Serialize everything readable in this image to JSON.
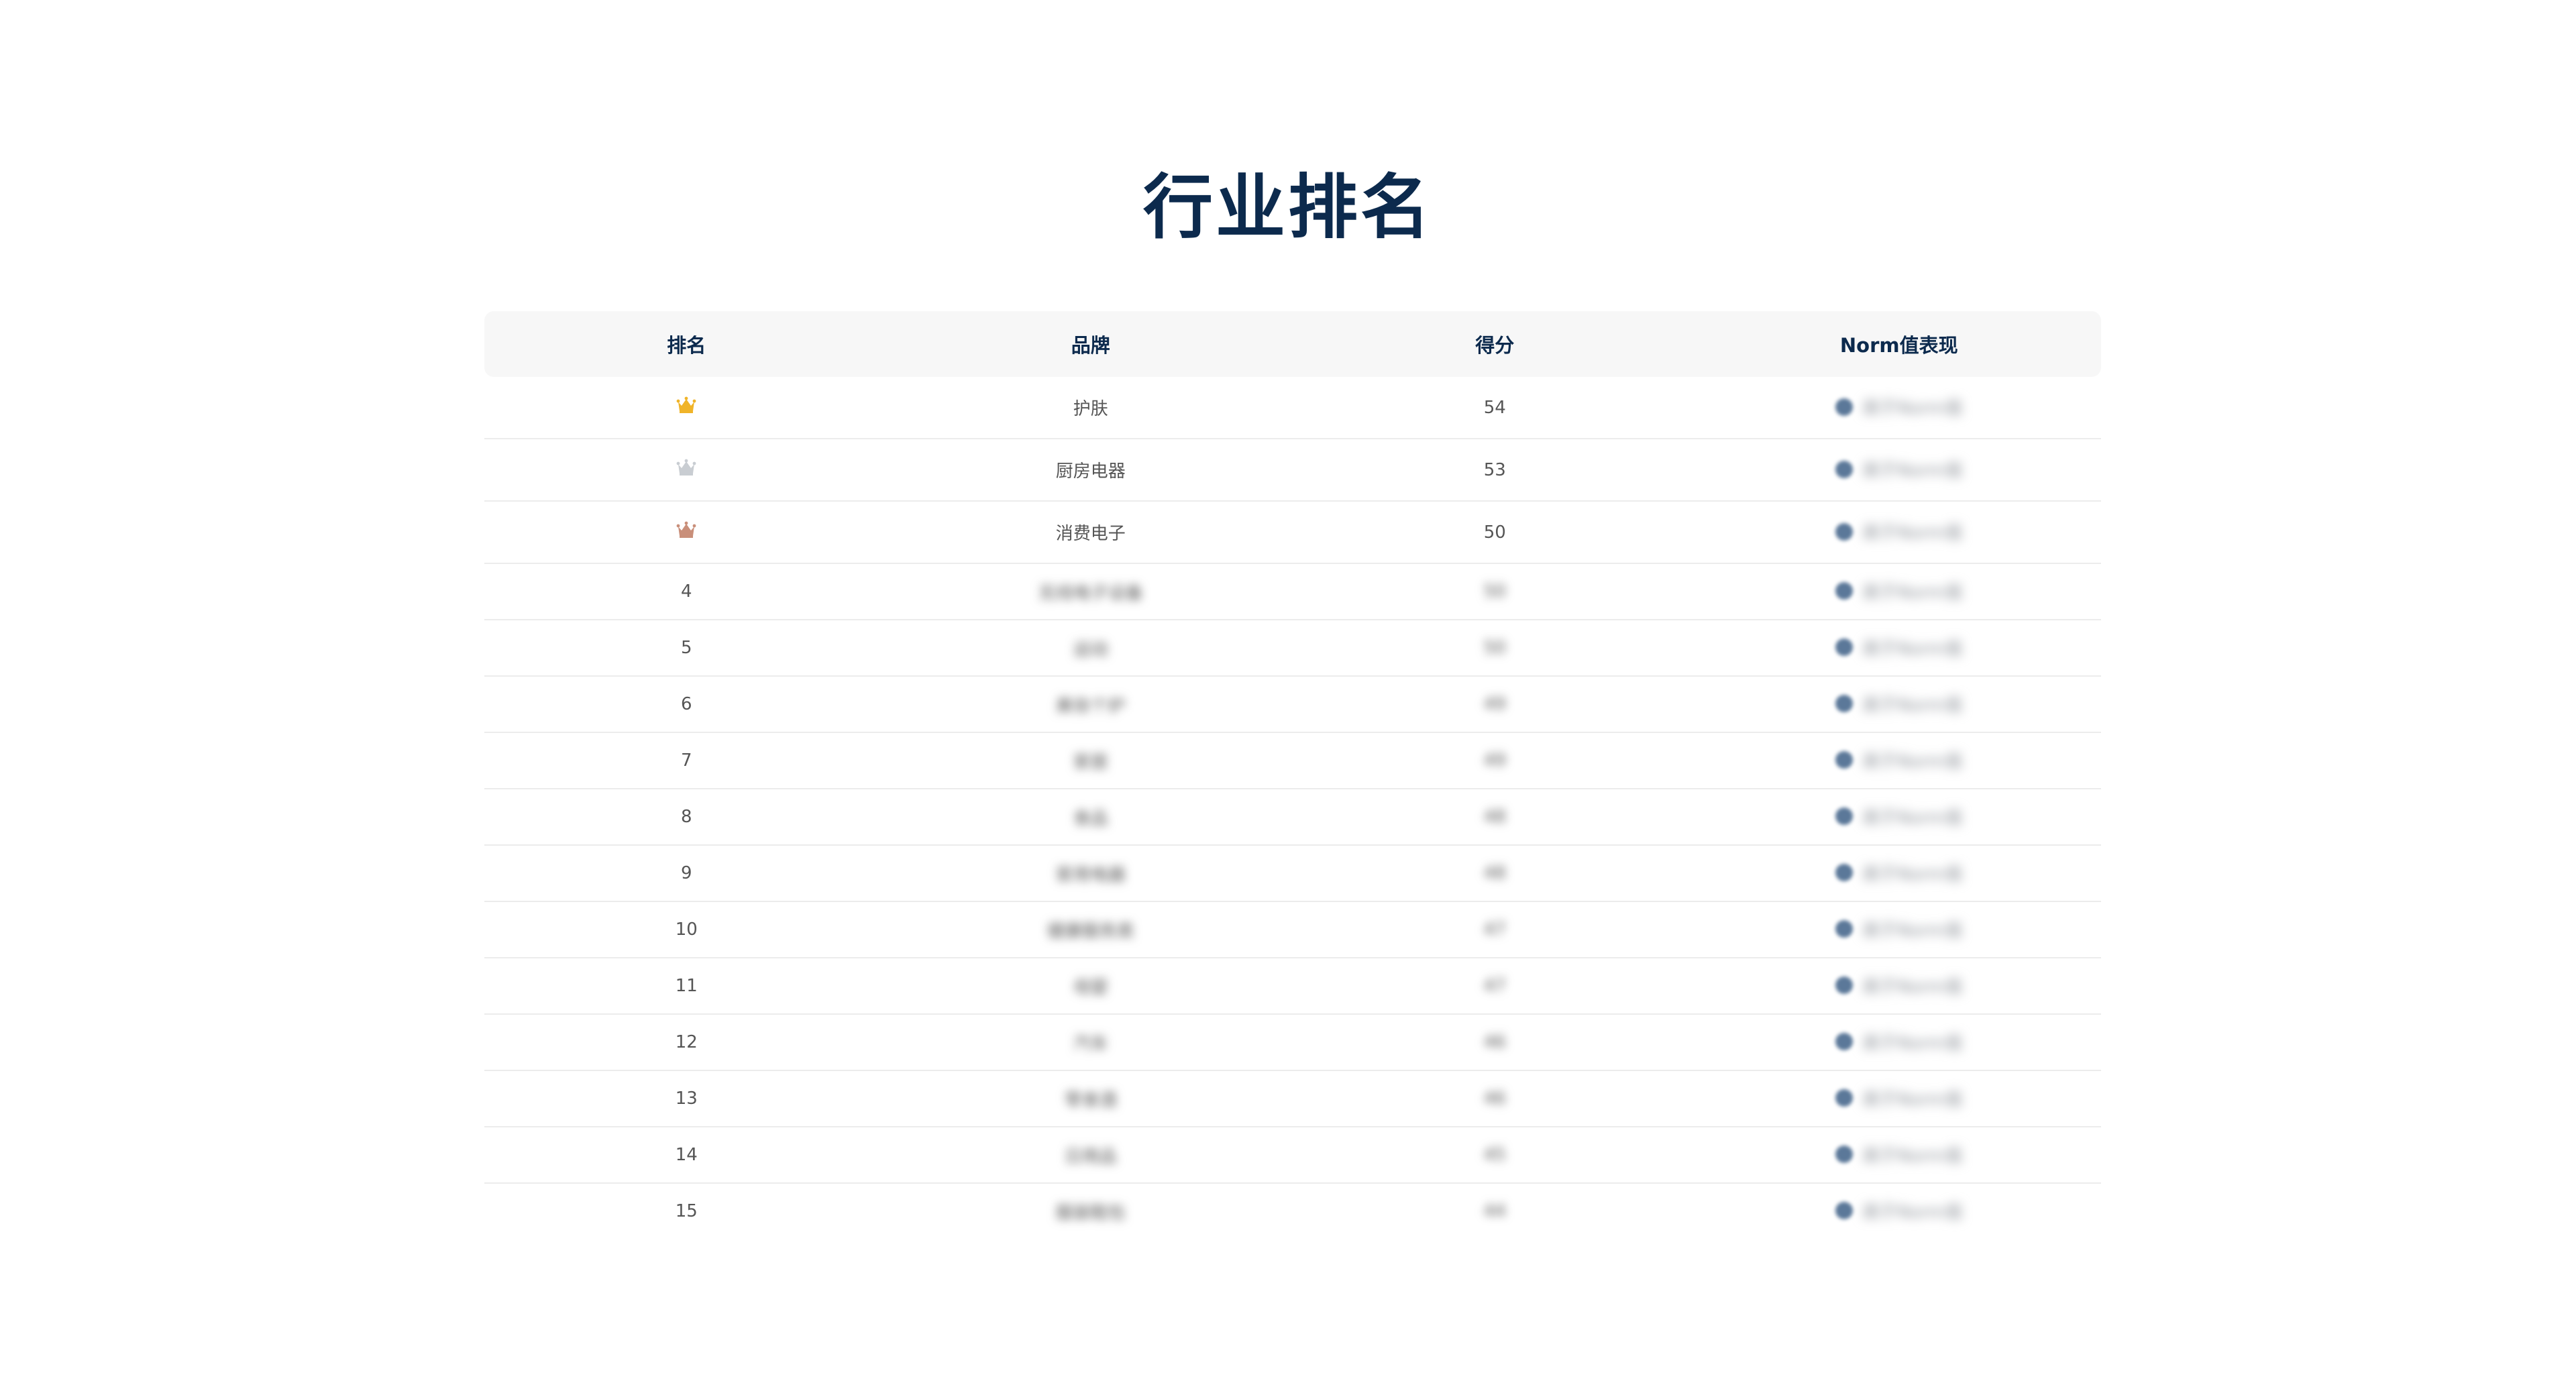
{
  "page": {
    "title": "行业排名"
  },
  "table": {
    "headers": {
      "rank": "排名",
      "brand": "品牌",
      "score": "得分",
      "norm": "Norm值表现"
    },
    "rows": [
      {
        "rank": "1",
        "crown": "gold-crown-icon",
        "brand": "护肤",
        "score": "54",
        "norm": "高于Norm值"
      },
      {
        "rank": "2",
        "crown": "silver-crown-icon",
        "brand": "厨房电器",
        "score": "53",
        "norm": "高于Norm值"
      },
      {
        "rank": "3",
        "crown": "bronze-crown-icon",
        "brand": "消费电子",
        "score": "50",
        "norm": "高于Norm值"
      },
      {
        "rank": "4",
        "brand": "无线电子设备",
        "score": "50",
        "norm": "高于Norm值"
      },
      {
        "rank": "5",
        "brand": "运动",
        "score": "50",
        "norm": "高于Norm值"
      },
      {
        "rank": "6",
        "brand": "美妆个护",
        "score": "49",
        "norm": "高于Norm值"
      },
      {
        "rank": "7",
        "brand": "家居",
        "score": "49",
        "norm": "高于Norm值"
      },
      {
        "rank": "8",
        "brand": "食品",
        "score": "48",
        "norm": "高于Norm值"
      },
      {
        "rank": "9",
        "brand": "家用电器",
        "score": "48",
        "norm": "高于Norm值"
      },
      {
        "rank": "10",
        "brand": "健康服务类",
        "score": "47",
        "norm": "高于Norm值"
      },
      {
        "rank": "11",
        "brand": "母婴",
        "score": "47",
        "norm": "高于Norm值"
      },
      {
        "rank": "12",
        "brand": "汽车",
        "score": "46",
        "norm": "高于Norm值"
      },
      {
        "rank": "13",
        "brand": "零食酒",
        "score": "46",
        "norm": "高于Norm值"
      },
      {
        "rank": "14",
        "brand": "日用品",
        "score": "45",
        "norm": "高于Norm值"
      },
      {
        "rank": "15",
        "brand": "服装鞋包",
        "score": "44",
        "norm": "高于Norm值"
      }
    ]
  },
  "colors": {
    "title": "#0c2a4d",
    "header_bg": "#f7f7f7",
    "gold": "#f0b429",
    "silver": "#c9cdd2",
    "bronze": "#c98f7a",
    "norm_dot": "#5b7899"
  }
}
